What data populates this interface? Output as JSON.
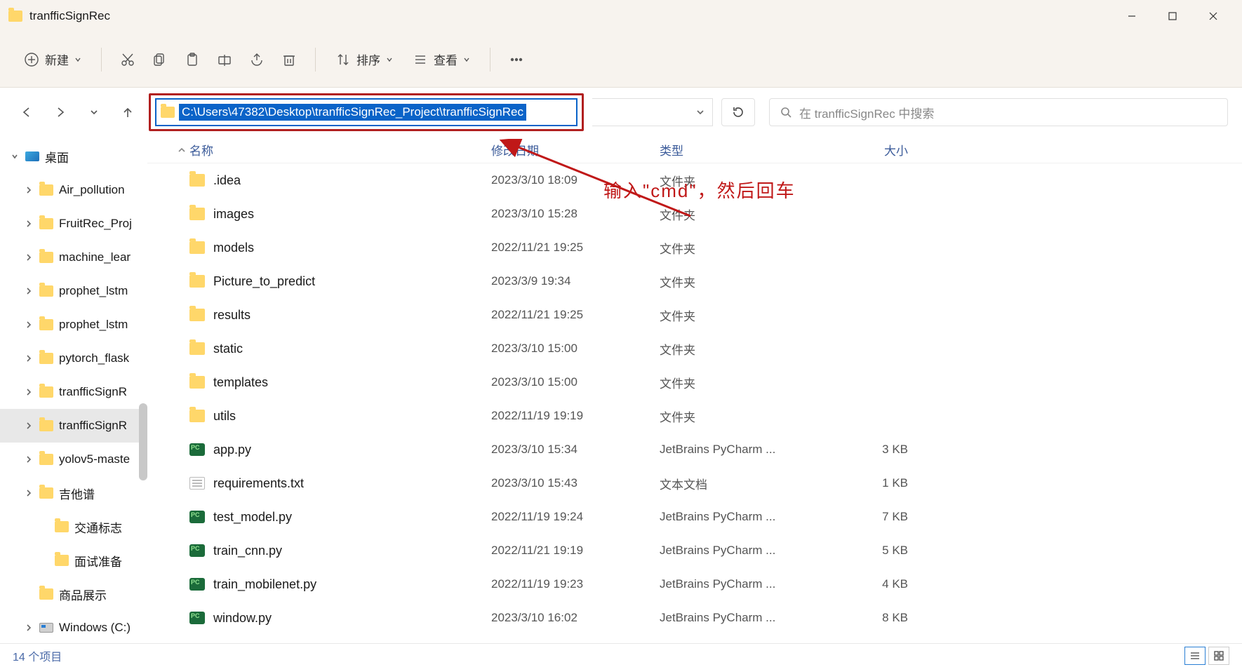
{
  "window": {
    "title": "tranfficSignRec"
  },
  "toolbar": {
    "new_label": "新建",
    "sort_label": "排序",
    "view_label": "查看"
  },
  "address": {
    "path": "C:\\Users\\47382\\Desktop\\tranfficSignRec_Project\\tranfficSignRec"
  },
  "search": {
    "placeholder": "在 tranfficSignRec 中搜索"
  },
  "columns": {
    "name": "名称",
    "date": "修改日期",
    "type": "类型",
    "size": "大小"
  },
  "sidebar": {
    "root": "桌面",
    "items": [
      "Air_pollution",
      "FruitRec_Proj",
      "machine_lear",
      "prophet_lstm",
      "prophet_lstm",
      "pytorch_flask",
      "tranfficSignR",
      "tranfficSignR",
      "yolov5-maste",
      "吉他谱",
      "交通标志",
      "面试准备",
      "商品展示",
      "Windows (C:)"
    ]
  },
  "files": [
    {
      "icon": "folder",
      "name": ".idea",
      "date": "2023/3/10 18:09",
      "type": "文件夹",
      "size": ""
    },
    {
      "icon": "folder",
      "name": "images",
      "date": "2023/3/10 15:28",
      "type": "文件夹",
      "size": ""
    },
    {
      "icon": "folder",
      "name": "models",
      "date": "2022/11/21 19:25",
      "type": "文件夹",
      "size": ""
    },
    {
      "icon": "folder",
      "name": "Picture_to_predict",
      "date": "2023/3/9 19:34",
      "type": "文件夹",
      "size": ""
    },
    {
      "icon": "folder",
      "name": "results",
      "date": "2022/11/21 19:25",
      "type": "文件夹",
      "size": ""
    },
    {
      "icon": "folder",
      "name": "static",
      "date": "2023/3/10 15:00",
      "type": "文件夹",
      "size": ""
    },
    {
      "icon": "folder",
      "name": "templates",
      "date": "2023/3/10 15:00",
      "type": "文件夹",
      "size": ""
    },
    {
      "icon": "folder",
      "name": "utils",
      "date": "2022/11/19 19:19",
      "type": "文件夹",
      "size": ""
    },
    {
      "icon": "py",
      "name": "app.py",
      "date": "2023/3/10 15:34",
      "type": "JetBrains PyCharm ...",
      "size": "3 KB"
    },
    {
      "icon": "txt",
      "name": "requirements.txt",
      "date": "2023/3/10 15:43",
      "type": "文本文档",
      "size": "1 KB"
    },
    {
      "icon": "py",
      "name": "test_model.py",
      "date": "2022/11/19 19:24",
      "type": "JetBrains PyCharm ...",
      "size": "7 KB"
    },
    {
      "icon": "py",
      "name": "train_cnn.py",
      "date": "2022/11/21 19:19",
      "type": "JetBrains PyCharm ...",
      "size": "5 KB"
    },
    {
      "icon": "py",
      "name": "train_mobilenet.py",
      "date": "2022/11/19 19:23",
      "type": "JetBrains PyCharm ...",
      "size": "4 KB"
    },
    {
      "icon": "py",
      "name": "window.py",
      "date": "2023/3/10 16:02",
      "type": "JetBrains PyCharm ...",
      "size": "8 KB"
    }
  ],
  "annotation": {
    "text": "输入\"cmd\"，然后回车"
  },
  "status": {
    "count": "14 个项目"
  }
}
